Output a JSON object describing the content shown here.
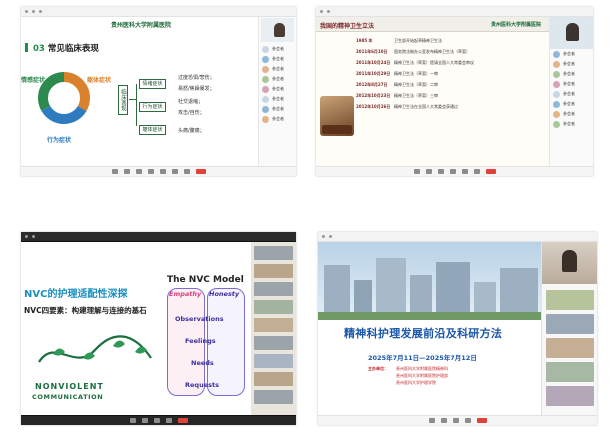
{
  "meeting1": {
    "window_title": "",
    "logo_text": "贵州医科大学附属医院",
    "slide_title_num": "03",
    "slide_title": "常见临床表现",
    "center_label": "临床表现",
    "segments": [
      {
        "label": "情感症状",
        "color": "#d9822b"
      },
      {
        "label": "躯体症状",
        "color": "#2f7bbf"
      },
      {
        "label": "行为症状",
        "color": "#2d8a4e"
      }
    ],
    "categories": [
      "情绪症状",
      "行为症状",
      "躯体症状"
    ],
    "leaves": [
      "过度恐惧/悲伤；",
      "易怒/焦躁暴发；",
      "社交退缩；",
      "攻击/自伤；",
      "头痛/腹痛；"
    ],
    "participants": [
      "参会者",
      "参会者",
      "参会者",
      "参会者",
      "参会者",
      "参会者",
      "参会者",
      "参会者"
    ]
  },
  "meeting2": {
    "slide_title": "我国的精神卫生立法",
    "logo_text": "贵州医科大学附属医院",
    "rows": [
      {
        "year": "1985 年",
        "text": "卫生部开始起草精神卫生法"
      },
      {
        "year": "2011年6月10日",
        "text": "国务院法制办公室发布精神卫生法（草案）"
      },
      {
        "year": "2011年10月24日",
        "text": "精神卫生法（草案）提请全国人大常委会审议"
      },
      {
        "year": "2011年10月29日",
        "text": "精神卫生法（草案）一审"
      },
      {
        "year": "2012年8月27日",
        "text": "精神卫生法（草案）二审"
      },
      {
        "year": "2012年10月23日",
        "text": "精神卫生法（草案）三审"
      },
      {
        "year": "2012年10月26日",
        "text": "精神卫生法在全国人大常委会获通过"
      }
    ],
    "participants": [
      "参会者",
      "参会者",
      "参会者",
      "参会者",
      "参会者",
      "参会者",
      "参会者",
      "参会者"
    ]
  },
  "meeting3": {
    "heading": "NVC的护理适配性深探",
    "subheading": "NVC四要素：构建理解与连接的基石",
    "logo_text": "NONVIOLENT",
    "logo_sub": "COMMUNICATION",
    "model_title": "The NVC Model",
    "model_cols": [
      "Honesty",
      "Empathy"
    ],
    "steps": [
      "Observations",
      "Feelings",
      "Needs",
      "Requests"
    ]
  },
  "meeting4": {
    "title": "精神科护理发展前沿及科研方法",
    "dates": "2025年7月11日—2025年7月12日",
    "host_label": "主办单位：",
    "hosts": [
      "贵州医科大学附属医院精神科",
      "贵州医科大学附属医院护理部",
      "贵州医科大学护理学院"
    ]
  }
}
